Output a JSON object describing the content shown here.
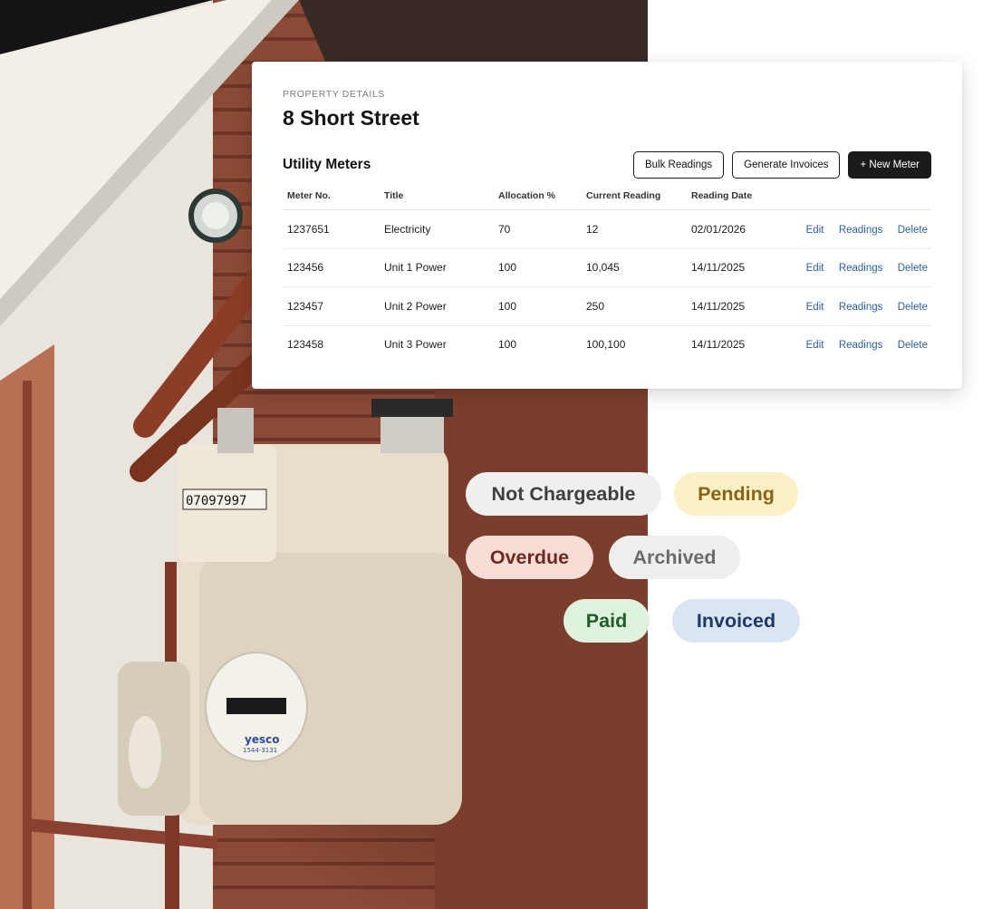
{
  "property": {
    "eyebrow": "PROPERTY DETAILS",
    "name": "8 Short Street"
  },
  "meters": {
    "title": "Utility Meters",
    "actions": {
      "bulk_readings": "Bulk Readings",
      "generate_invoices": "Generate Invoices",
      "new_meter": "+ New Meter"
    },
    "columns": [
      "Meter No.",
      "Title",
      "Allocation %",
      "Current Reading",
      "Reading Date"
    ],
    "row_actions": {
      "edit": "Edit",
      "readings": "Readings",
      "delete": "Delete"
    },
    "rows": [
      {
        "meter_no": "1237651",
        "title": "Electricity",
        "allocation": "70",
        "reading": "12",
        "date": "02/01/2026"
      },
      {
        "meter_no": "123456",
        "title": "Unit 1 Power",
        "allocation": "100",
        "reading": "10,045",
        "date": "14/11/2025"
      },
      {
        "meter_no": "123457",
        "title": "Unit 2 Power",
        "allocation": "100",
        "reading": "250",
        "date": "14/11/2025"
      },
      {
        "meter_no": "123458",
        "title": "Unit 3 Power",
        "allocation": "100",
        "reading": "100,100",
        "date": "14/11/2025"
      }
    ]
  },
  "statuses": {
    "not_chargeable": "Not Chargeable",
    "pending": "Pending",
    "overdue": "Overdue",
    "archived": "Archived",
    "paid": "Paid",
    "invoiced": "Invoiced"
  },
  "colors": {
    "primary_button": "#1b1b1b",
    "link": "#2b5ea8",
    "not_chargeable_bg": "#efefef",
    "not_chargeable_fg": "#3f3f3f",
    "pending_bg": "#fbf0c6",
    "pending_fg": "#8a6314",
    "overdue_bg": "#f8dcd6",
    "overdue_fg": "#6e2a22",
    "archived_bg": "#eeeeec",
    "archived_fg": "#6b6b6b",
    "paid_bg": "#dff2de",
    "paid_fg": "#235a2a",
    "invoiced_bg": "#dbe4f3",
    "invoiced_fg": "#1d3b66"
  },
  "photo": {
    "meter_counter": "07097997",
    "meter_brand": "yesco",
    "meter_phone": "1544-3131"
  }
}
